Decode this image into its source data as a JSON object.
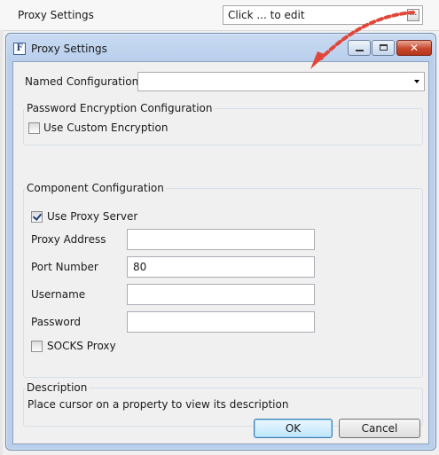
{
  "background": {
    "property_label": "Proxy Settings",
    "property_value": "Click ... to edit",
    "ellipsis": "..."
  },
  "window": {
    "title": "Proxy Settings",
    "app_icon_letter": "F",
    "close_glyph": "✕"
  },
  "form": {
    "named_configuration_label": "Named Configuration",
    "named_configuration_value": "",
    "password_group_title": "Password Encryption Configuration",
    "use_custom_encryption_label": "Use Custom Encryption",
    "use_custom_encryption_checked": false,
    "component_group_title": "Component Configuration",
    "use_proxy_server_label": "Use Proxy Server",
    "use_proxy_server_checked": true,
    "proxy_address_label": "Proxy Address",
    "proxy_address_value": "",
    "port_number_label": "Port Number",
    "port_number_value": "80",
    "username_label": "Username",
    "username_value": "",
    "password_label": "Password",
    "password_value": "",
    "socks_proxy_label": "SOCKS Proxy",
    "socks_proxy_checked": false
  },
  "description": {
    "title": "Description",
    "text": "Place cursor on a property to view its description"
  },
  "buttons": {
    "ok": "OK",
    "cancel": "Cancel"
  },
  "colors": {
    "annotation_arrow": "#e0473a",
    "title_bar": "#b9cfec"
  }
}
